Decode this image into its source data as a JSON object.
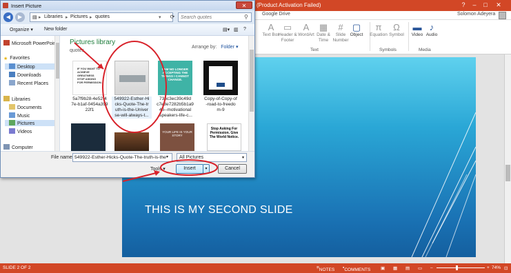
{
  "ppt": {
    "titlebar": "(Product Activation Failed)",
    "tab": "Google Drive",
    "user": "Solomon Adeyera",
    "ribbon": {
      "buttons": [
        "Text Box",
        "Header & Footer",
        "WordArt",
        "Date & Time",
        "Slide Number",
        "Object",
        "Equation",
        "Symbol",
        "Video",
        "Audio"
      ],
      "groups": [
        "Text",
        "Symbols",
        "Media"
      ]
    },
    "slide_title": "THIS IS MY SECOND SLIDE",
    "status": {
      "slide": "SLIDE 2 OF 2",
      "notes": "NOTES",
      "comments": "COMMENTS",
      "zoom": "74%"
    },
    "colors": {
      "accent": "#d24726",
      "slide_top": "#5fd1ee",
      "slide_bottom": "#145f9f"
    }
  },
  "dialog": {
    "title": "Insert Picture",
    "breadcrumb": [
      "Libraries",
      "Pictures",
      "quotes"
    ],
    "search_placeholder": "Search quotes",
    "toolbar": {
      "organize": "Organize ▾",
      "new_folder": "New folder"
    },
    "nav": {
      "items": [
        {
          "label": "Microsoft PowerPoint",
          "icon": "powerpoint-icon"
        },
        {
          "label": "Favorites",
          "icon": "star-icon"
        },
        {
          "label": "Desktop",
          "icon": "desktop-icon"
        },
        {
          "label": "Downloads",
          "icon": "downloads-icon"
        },
        {
          "label": "Recent Places",
          "icon": "recent-icon"
        },
        {
          "label": "Libraries",
          "icon": "libraries-icon"
        },
        {
          "label": "Documents",
          "icon": "documents-icon"
        },
        {
          "label": "Music",
          "icon": "music-icon"
        },
        {
          "label": "Pictures",
          "icon": "pictures-icon"
        },
        {
          "label": "Videos",
          "icon": "videos-icon"
        },
        {
          "label": "Computer",
          "icon": "computer-icon"
        }
      ]
    },
    "library": {
      "title": "Pictures library",
      "subtitle": "quotes",
      "arrange_label": "Arrange by:",
      "arrange_value": "Folder ▾"
    },
    "files": [
      {
        "caption": "5a7f9b28-4e52-4\n7e-b1af-0454a399\n22f1",
        "text": "IF YOU WANT TO ACHIEVE GREATNESS STOP ASKING FOR PERMISSION."
      },
      {
        "caption": "549922-Esther-Hi\ncks-Quote-The-tr\nuth-is-the-Univer\nse-will-always-t...",
        "text": ""
      },
      {
        "caption": "736c3ec39c49d\nc7e8e7282b5b1a9\n46--motivational\n-speakers-life-c...",
        "text": "I AM NO LONGER ACCEPTING THE THINGS I CANNOT CHANGE."
      },
      {
        "caption": "Copy-of-Copy-of\n-road-to-freedo\nm-9",
        "text": ""
      },
      {
        "caption": "",
        "text": ""
      },
      {
        "caption": "",
        "text": ""
      },
      {
        "caption": "",
        "text": "YOUR LIFE IS YOUR STORY"
      },
      {
        "caption": "",
        "text": "Stop Asking For Permission. Give The World Notice."
      }
    ],
    "file_name_label": "File name:",
    "file_name_value": "549922-Esther-Hicks-Quote-The-truth-is-the",
    "filter": "All Pictures",
    "tools": "Tools",
    "insert": "Insert",
    "cancel": "Cancel"
  }
}
